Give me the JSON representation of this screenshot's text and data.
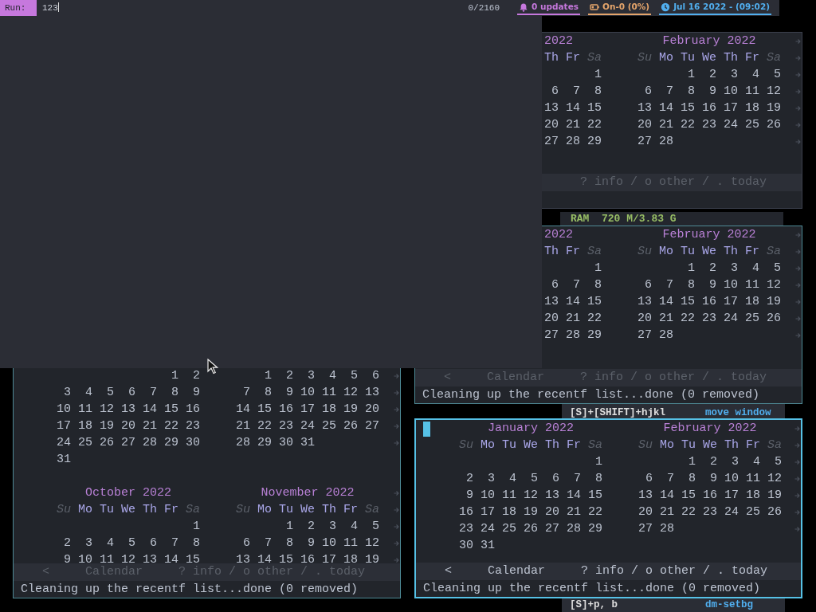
{
  "topbar": {
    "prompt": "Run:",
    "input": "123",
    "count": "0/2160",
    "modules": [
      {
        "kind": "updates",
        "text": "0 updates",
        "color": "#c678dd"
      },
      {
        "kind": "battery",
        "text": "On-0 (0%)",
        "color": "#e5a56b"
      },
      {
        "kind": "clock",
        "text": "Jul 16 2022 - (09:02)",
        "color": "#51afef"
      }
    ]
  },
  "windows": [
    {
      "focused": false,
      "month_rows": [
        {
          "months": [
            {
              "title": "2022",
              "weekdays": [
                {
                  "label": "Th",
                  "weekend": false
                },
                {
                  "label": "Fr",
                  "weekend": false
                },
                {
                  "label": "Sa",
                  "weekend": true
                }
              ],
              "weeks": [
                "       1",
                " 6  7  8",
                "13 14 15",
                "20 21 22",
                "27 28 29"
              ]
            },
            {
              "title": "February 2022",
              "weekdays": [
                {
                  "label": "Su",
                  "weekend": true
                },
                {
                  "label": "Mo",
                  "weekend": false
                },
                {
                  "label": "Tu",
                  "weekend": false
                },
                {
                  "label": "We",
                  "weekend": false
                },
                {
                  "label": "Th",
                  "weekend": false
                },
                {
                  "label": "Fr",
                  "weekend": false
                },
                {
                  "label": "Sa",
                  "weekend": true
                }
              ],
              "weeks": [
                "       1  2  3  4  5",
                " 6  7  8  9 10 11 12",
                "13 14 15 16 17 18 19",
                "20 21 22 23 24 25 26",
                "27 28"
              ]
            }
          ]
        }
      ],
      "footer": [
        {
          "kind": "hints",
          "text": "? info / o other / . today"
        }
      ]
    },
    {
      "focused": false,
      "month_rows": [
        {
          "months": [
            {
              "title": "2022",
              "weekdays": [
                {
                  "label": "Th",
                  "weekend": false
                },
                {
                  "label": "Fr",
                  "weekend": false
                },
                {
                  "label": "Sa",
                  "weekend": true
                }
              ],
              "weeks": [
                "       1",
                " 6  7  8",
                "13 14 15",
                "20 21 22",
                "27 28 29"
              ]
            },
            {
              "title": "February 2022",
              "weekdays": [
                {
                  "label": "Su",
                  "weekend": true
                },
                {
                  "label": "Mo",
                  "weekend": false
                },
                {
                  "label": "Tu",
                  "weekend": false
                },
                {
                  "label": "We",
                  "weekend": false
                },
                {
                  "label": "Th",
                  "weekend": false
                },
                {
                  "label": "Fr",
                  "weekend": false
                },
                {
                  "label": "Sa",
                  "weekend": true
                }
              ],
              "weeks": [
                "       1  2  3  4  5",
                " 6  7  8  9 10 11 12",
                "13 14 15 16 17 18 19",
                "20 21 22 23 24 25 26",
                "27 28"
              ]
            }
          ]
        }
      ],
      "footer": [
        {
          "kind": "back",
          "text": "<"
        },
        {
          "kind": "title",
          "text": "Calendar"
        },
        {
          "kind": "hints",
          "text": "? info / o other / . today"
        }
      ],
      "message": "Cleaning up the recentf list...done (0 removed)"
    },
    {
      "focused": false,
      "month_rows": [
        {
          "months": [
            {
              "weeks": [
                "                1  2",
                " 3  4  5  6  7  8  9",
                "10 11 12 13 14 15 16",
                "17 18 19 20 21 22 23",
                "24 25 26 27 28 29 30",
                "31"
              ]
            },
            {
              "weeks": [
                "    1  2  3  4  5  6",
                " 7  8  9 10 11 12 13",
                "14 15 16 17 18 19 20",
                "21 22 23 24 25 26 27",
                "28 29 30 31"
              ]
            }
          ]
        },
        {
          "months": [
            {
              "title": "October 2022",
              "weekdays": [
                {
                  "label": "Su",
                  "weekend": true
                },
                {
                  "label": "Mo",
                  "weekend": false
                },
                {
                  "label": "Tu",
                  "weekend": false
                },
                {
                  "label": "We",
                  "weekend": false
                },
                {
                  "label": "Th",
                  "weekend": false
                },
                {
                  "label": "Fr",
                  "weekend": false
                },
                {
                  "label": "Sa",
                  "weekend": true
                }
              ],
              "weeks": [
                "                   1",
                " 2  3  4  5  6  7  8",
                " 9 10 11 12 13 14 15"
              ]
            },
            {
              "title": "November 2022",
              "weekdays": [
                {
                  "label": "Su",
                  "weekend": true
                },
                {
                  "label": "Mo",
                  "weekend": false
                },
                {
                  "label": "Tu",
                  "weekend": false
                },
                {
                  "label": "We",
                  "weekend": false
                },
                {
                  "label": "Th",
                  "weekend": false
                },
                {
                  "label": "Fr",
                  "weekend": false
                },
                {
                  "label": "Sa",
                  "weekend": true
                }
              ],
              "weeks": [
                "       1  2  3  4  5",
                " 6  7  8  9 10 11 12",
                "13 14 15 16 17 18 19"
              ]
            }
          ]
        }
      ],
      "footer": [
        {
          "kind": "back",
          "text": "<"
        },
        {
          "kind": "title",
          "text": "Calendar"
        },
        {
          "kind": "hints",
          "text": "? info / o other / . today"
        }
      ],
      "message": "Cleaning up the recentf list...done (0 removed)"
    },
    {
      "focused": true,
      "month_rows": [
        {
          "months": [
            {
              "title": "January 2022",
              "weekdays": [
                {
                  "label": "Su",
                  "weekend": true
                },
                {
                  "label": "Mo",
                  "weekend": false
                },
                {
                  "label": "Tu",
                  "weekend": false
                },
                {
                  "label": "We",
                  "weekend": false
                },
                {
                  "label": "Th",
                  "weekend": false
                },
                {
                  "label": "Fr",
                  "weekend": false
                },
                {
                  "label": "Sa",
                  "weekend": true
                }
              ],
              "weeks": [
                "                   1",
                " 2  3  4  5  6  7  8",
                " 9 10 11 12 13 14 15",
                "16 17 18 19 20 21 22",
                "23 24 25 26 27 28 29",
                "30 31"
              ]
            },
            {
              "title": "February 2022",
              "weekdays": [
                {
                  "label": "Su",
                  "weekend": true
                },
                {
                  "label": "Mo",
                  "weekend": false
                },
                {
                  "label": "Tu",
                  "weekend": false
                },
                {
                  "label": "We",
                  "weekend": false
                },
                {
                  "label": "Th",
                  "weekend": false
                },
                {
                  "label": "Fr",
                  "weekend": false
                },
                {
                  "label": "Sa",
                  "weekend": true
                }
              ],
              "weeks": [
                "       1  2  3  4  5",
                " 6  7  8  9 10 11 12",
                "13 14 15 16 17 18 19",
                "20 21 22 23 24 25 26",
                "27 28"
              ]
            }
          ]
        }
      ],
      "footer": [
        {
          "kind": "back",
          "text": "<"
        },
        {
          "kind": "title",
          "text": "Calendar"
        },
        {
          "kind": "hints",
          "text": "? info / o other / . today"
        }
      ],
      "message": "Cleaning up the recentf list...done (0 removed)"
    }
  ],
  "ram": {
    "label": "RAM",
    "value": "720 M/3.83 G"
  },
  "keybindings": [
    {
      "keys": "[S]+[SHIFT]+hjkl",
      "action": "move window"
    },
    {
      "keys": "[S]+p, b",
      "action": "dm-setbg"
    }
  ]
}
